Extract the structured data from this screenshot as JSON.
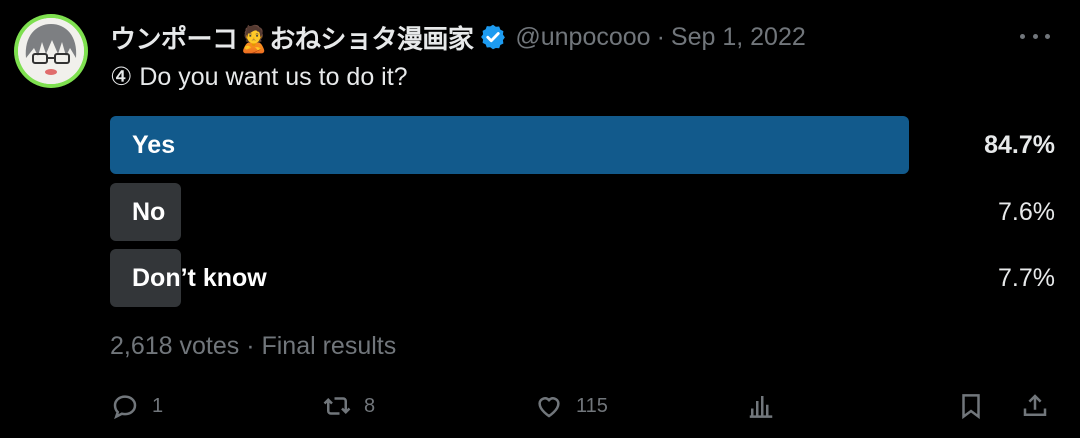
{
  "author": {
    "display_name": "ウンポーコ🙎おねショタ漫画家",
    "handle": "@unpocooo",
    "separator": "·",
    "date": "Sep 1, 2022"
  },
  "tweet": {
    "text": "④ Do you want us to do it?"
  },
  "poll": {
    "options": [
      {
        "label": "Yes",
        "percent": "84.7%",
        "value": 84.7,
        "winner": true
      },
      {
        "label": "No",
        "percent": "7.6%",
        "value": 7.6,
        "winner": false
      },
      {
        "label": "Don’t know",
        "percent": "7.7%",
        "value": 7.7,
        "winner": false
      }
    ],
    "meta": "2,618 votes · Final results"
  },
  "actions": {
    "replies": "1",
    "reposts": "8",
    "likes": "115"
  },
  "colors": {
    "winner_bar": "#125a8c",
    "other_bar": "#333639",
    "muted_text": "#71767b",
    "verified_badge": "#1d9bf0",
    "avatar_ring": "#7ee04f"
  }
}
